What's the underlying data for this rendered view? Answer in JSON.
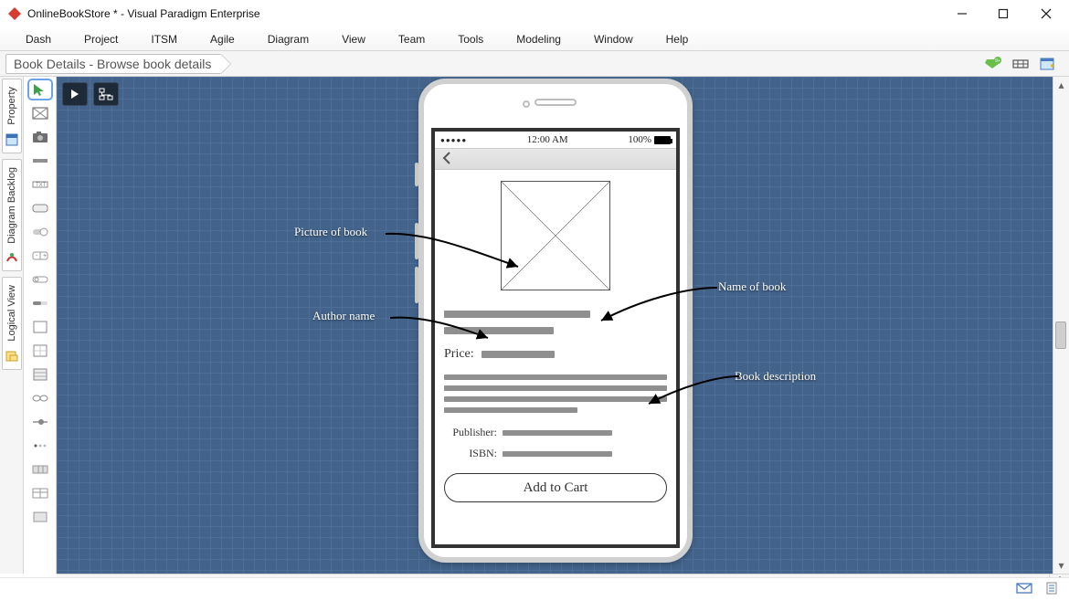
{
  "app": {
    "title": "OnlineBookStore * - Visual Paradigm Enterprise"
  },
  "menu": {
    "items": [
      "Dash",
      "Project",
      "ITSM",
      "Agile",
      "Diagram",
      "View",
      "Team",
      "Tools",
      "Modeling",
      "Window",
      "Help"
    ]
  },
  "breadcrumb": {
    "label": "Book Details - Browse book details"
  },
  "side_tabs": {
    "groups": [
      {
        "label": "Property"
      },
      {
        "label": "Diagram Backlog"
      },
      {
        "label": "Logical View"
      }
    ]
  },
  "phone": {
    "status": {
      "time": "12:00 AM",
      "battery": "100%"
    },
    "price_label": "Price:",
    "publisher_label": "Publisher:",
    "isbn_label": "ISBN:",
    "add_to_cart": "Add to Cart"
  },
  "annotations": {
    "picture": "Picture of book",
    "author": "Author name",
    "name": "Name of book",
    "description": "Book description"
  }
}
